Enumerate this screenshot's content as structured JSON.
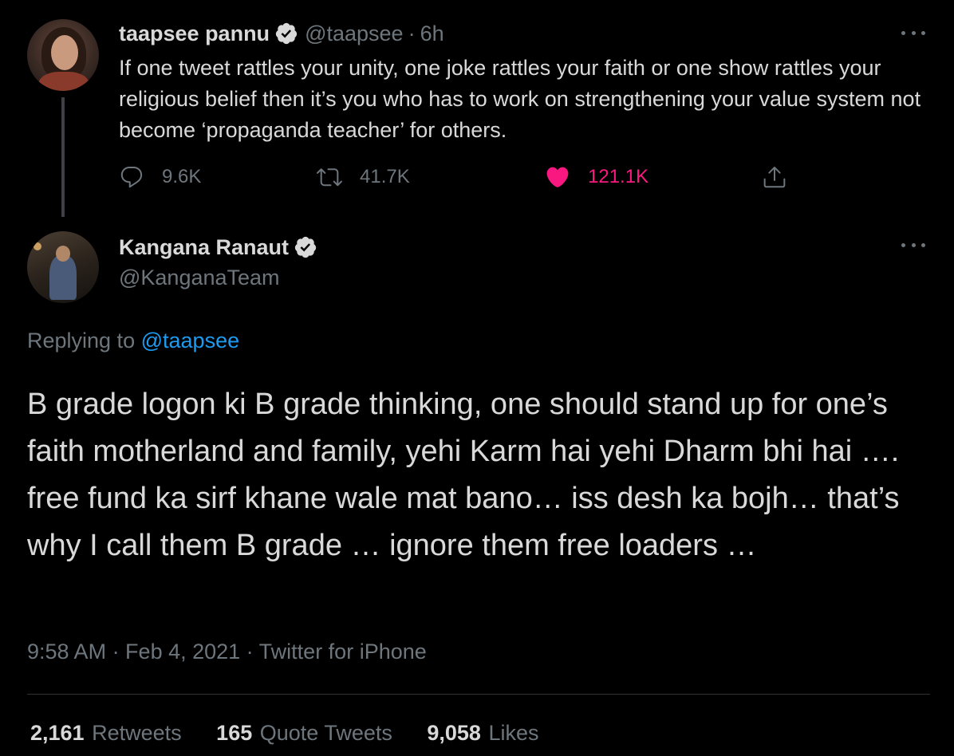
{
  "parent_tweet": {
    "display_name": "taapsee pannu",
    "handle": "@taapsee",
    "separator": "·",
    "time_ago": "6h",
    "text": "If one tweet rattles your unity, one joke rattles your faith or one show rattles your religious belief then it’s you who has to work on strengthening your value system not become ‘propaganda teacher’ for others.",
    "replies": "9.6K",
    "retweets": "41.7K",
    "likes": "121.1K",
    "verified": true,
    "like_color": "#f91880"
  },
  "main_tweet": {
    "display_name": "Kangana Ranaut",
    "handle": "@KanganaTeam",
    "verified": true,
    "replying_label": "Replying to",
    "replying_to": "@taapsee",
    "text": "B grade logon ki B grade thinking, one should stand up for one’s faith motherland and family, yehi Karm hai yehi Dharm bhi hai …. free fund ka sirf khane wale mat bano… iss desh ka bojh… that’s why I call them B grade … ignore them free loaders …",
    "meta": "9:58 AM · Feb 4, 2021 · Twitter for iPhone",
    "stats": {
      "retweets_count": "2,161",
      "retweets_label": "Retweets",
      "quotes_count": "165",
      "quotes_label": "Quote Tweets",
      "likes_count": "9,058",
      "likes_label": "Likes"
    }
  },
  "colors": {
    "background": "#000000",
    "text": "#d9d9d9",
    "secondary": "#6e767d",
    "link": "#1d9bf0",
    "verified_badge": "#d9d9d9"
  },
  "icons": {
    "verified": "verified-badge-icon",
    "more": "more-horizontal-icon",
    "reply": "reply-icon",
    "retweet": "retweet-icon",
    "like": "heart-filled-icon",
    "share": "share-icon"
  }
}
